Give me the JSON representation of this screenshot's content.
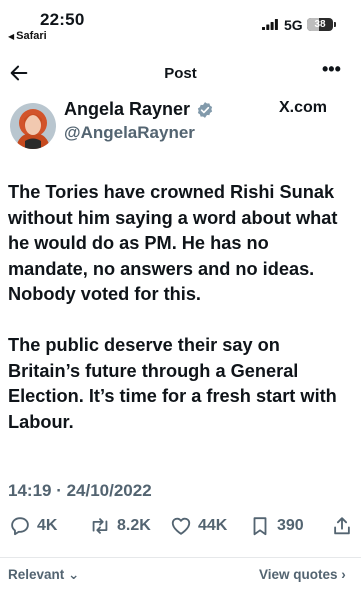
{
  "status_bar": {
    "time": "22:50",
    "back_app": "Safari",
    "network": "5G",
    "battery": "38"
  },
  "nav": {
    "title": "Post"
  },
  "author": {
    "name": "Angela Rayner",
    "handle": "@AngelaRayner",
    "source": "X.com"
  },
  "tweet": {
    "paragraphs": [
      "The Tories have crowned Rishi Sunak without him saying a word about what he would do as PM. He has no mandate, no answers and no ideas. Nobody voted for this.",
      "The public deserve their say on Britain’s future through a General Election. It’s time for a fresh start with Labour."
    ],
    "timestamp": "14:19 · 24/10/2022"
  },
  "stats": {
    "replies": "4K",
    "reposts": "8.2K",
    "likes": "44K",
    "bookmarks": "390"
  },
  "footer": {
    "sort": "Relevant",
    "view_quotes": "View quotes"
  },
  "colors": {
    "text": "#0f1419",
    "secondary": "#536471",
    "verified": "#829aab"
  }
}
